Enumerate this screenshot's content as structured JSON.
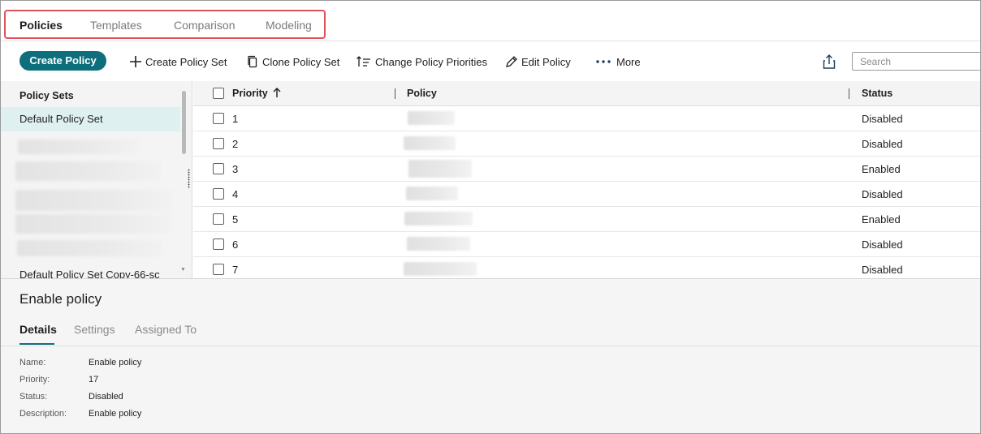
{
  "top_tabs": [
    {
      "label": "Policies",
      "active": true
    },
    {
      "label": "Templates",
      "active": false
    },
    {
      "label": "Comparison",
      "active": false
    },
    {
      "label": "Modeling",
      "active": false
    }
  ],
  "toolbar": {
    "create_policy": "Create Policy",
    "create_policy_set": "Create Policy Set",
    "clone_policy_set": "Clone Policy Set",
    "change_priorities": "Change Policy Priorities",
    "edit_policy": "Edit Policy",
    "more": "More",
    "search_placeholder": "Search"
  },
  "policy_sets": {
    "header": "Policy Sets",
    "items": [
      {
        "label": "Default Policy Set",
        "selected": true
      },
      {
        "label": "Default Policy Set Copy-66-sc",
        "selected": false
      }
    ]
  },
  "table": {
    "columns": [
      "Priority",
      "Policy",
      "Status"
    ],
    "rows": [
      {
        "priority": "1",
        "status": "Disabled"
      },
      {
        "priority": "2",
        "status": "Disabled"
      },
      {
        "priority": "3",
        "status": "Enabled"
      },
      {
        "priority": "4",
        "status": "Disabled"
      },
      {
        "priority": "5",
        "status": "Enabled"
      },
      {
        "priority": "6",
        "status": "Disabled"
      },
      {
        "priority": "7",
        "status": "Disabled"
      }
    ]
  },
  "details": {
    "title": "Enable policy",
    "tabs": [
      {
        "label": "Details",
        "active": true
      },
      {
        "label": "Settings",
        "active": false
      },
      {
        "label": "Assigned To",
        "active": false
      }
    ],
    "fields": [
      {
        "label": "Name:",
        "value": "Enable policy"
      },
      {
        "label": "Priority:",
        "value": "17"
      },
      {
        "label": "Status:",
        "value": "Disabled"
      },
      {
        "label": "Description:",
        "value": "Enable policy"
      }
    ]
  },
  "colors": {
    "accent": "#0e6f7c",
    "highlight_border": "#e0525a",
    "selected_row": "#dff0f1"
  }
}
